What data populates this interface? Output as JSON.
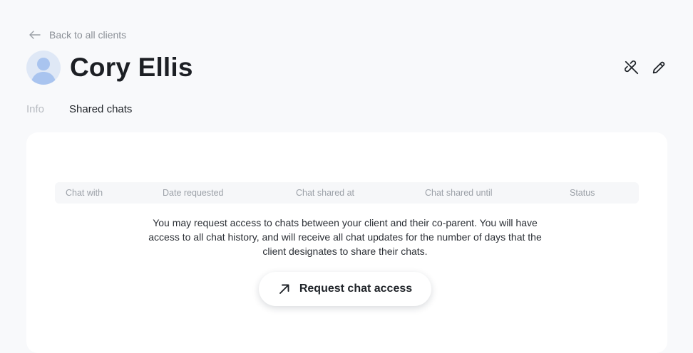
{
  "nav": {
    "back_label": "Back to all clients"
  },
  "client": {
    "name": "Cory Ellis"
  },
  "tabs": [
    {
      "label": "Info",
      "active": false
    },
    {
      "label": "Shared chats",
      "active": true
    }
  ],
  "table": {
    "columns": [
      "Chat with",
      "Date requested",
      "Chat shared at",
      "Chat shared until",
      "Status"
    ]
  },
  "empty_state": {
    "message": "You may request access to chats between your client and their co-parent. You will have access to all chat history, and will receive all chat updates for the number of days that the client designates to share their chats.",
    "button_label": "Request chat access"
  },
  "icons": {
    "back": "arrow-left-icon",
    "avatar": "user-avatar-icon",
    "unlink": "unlink-icon",
    "edit": "pencil-icon",
    "request": "arrow-up-right-icon"
  },
  "colors": {
    "background": "#f8f9fb",
    "card": "#ffffff",
    "muted_text": "#8b9097",
    "avatar_fill": "#a9c4ef"
  }
}
